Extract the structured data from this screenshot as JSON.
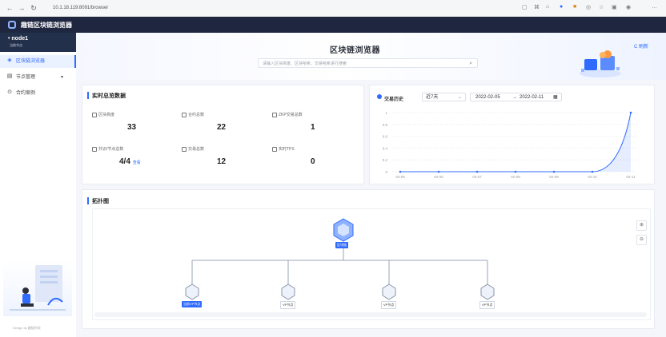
{
  "browser": {
    "url": "10.1.18.119:8091/browser",
    "icons": [
      "back-icon",
      "forward-icon",
      "reload-icon",
      "reader-icon",
      "grid-icon",
      "tab-icon",
      "profile-icon",
      "mask-icon",
      "browser-icon",
      "favorites-icon",
      "collections-icon",
      "account-icon",
      "more-icon"
    ]
  },
  "app": {
    "title": "趣链区块链浏览器"
  },
  "sidebar": {
    "node": {
      "name": "node1",
      "sub": "当前节点"
    },
    "items": [
      {
        "label": "区块链浏览器",
        "icon": "cube-icon",
        "active": true
      },
      {
        "label": "节点管理",
        "icon": "server-icon",
        "active": false,
        "has_caret": true
      },
      {
        "label": "合约案例",
        "icon": "contract-icon",
        "active": false
      }
    ],
    "illustration_caption": "Design by 趣链科技"
  },
  "hero": {
    "title": "区块链浏览器",
    "search_placeholder": "请输入区块高度、区块哈希、交易哈希进行搜索",
    "refresh": "C 刷新"
  },
  "stats": {
    "title": "实时总览数据",
    "items": [
      {
        "label": "区块高度",
        "value": "33"
      },
      {
        "label": "合约总数",
        "value": "22"
      },
      {
        "label": "ZKP交易总数",
        "value": "1"
      },
      {
        "label": "共识/节点总数",
        "value": "4/4",
        "link": "查看"
      },
      {
        "label": "交易总数",
        "value": "12"
      },
      {
        "label": "实时TPS",
        "value": "0"
      }
    ]
  },
  "tx_history": {
    "title": "交易历史",
    "range_label": "近7天",
    "date_from": "2022-02-05",
    "arrow": "→",
    "date_to": "2022-02-11",
    "chart_data": {
      "type": "area",
      "categories": [
        "02-05",
        "02-06",
        "02-07",
        "02-08",
        "02-09",
        "02-10",
        "02-11"
      ],
      "values": [
        0,
        0,
        0,
        0,
        0,
        0,
        1
      ],
      "yticks": [
        "1",
        "0.8",
        "0.6",
        "0.4",
        "0.2",
        "0"
      ],
      "ylim": [
        0,
        1
      ],
      "grid": true,
      "color": "#2f6bff"
    }
  },
  "topology": {
    "title": "拓扑图",
    "root": {
      "label": "区块链"
    },
    "children": [
      {
        "label": "当前VP节点",
        "highlight": true
      },
      {
        "label": "VP节点",
        "highlight": false
      },
      {
        "label": "VP节点",
        "highlight": false
      },
      {
        "label": "VP节点",
        "highlight": false
      }
    ],
    "zoom_in": "⊕",
    "zoom_out": "⊖"
  },
  "colors": {
    "accent": "#2f6bff",
    "appbar": "#1f2740",
    "node_box": "#23304b"
  }
}
